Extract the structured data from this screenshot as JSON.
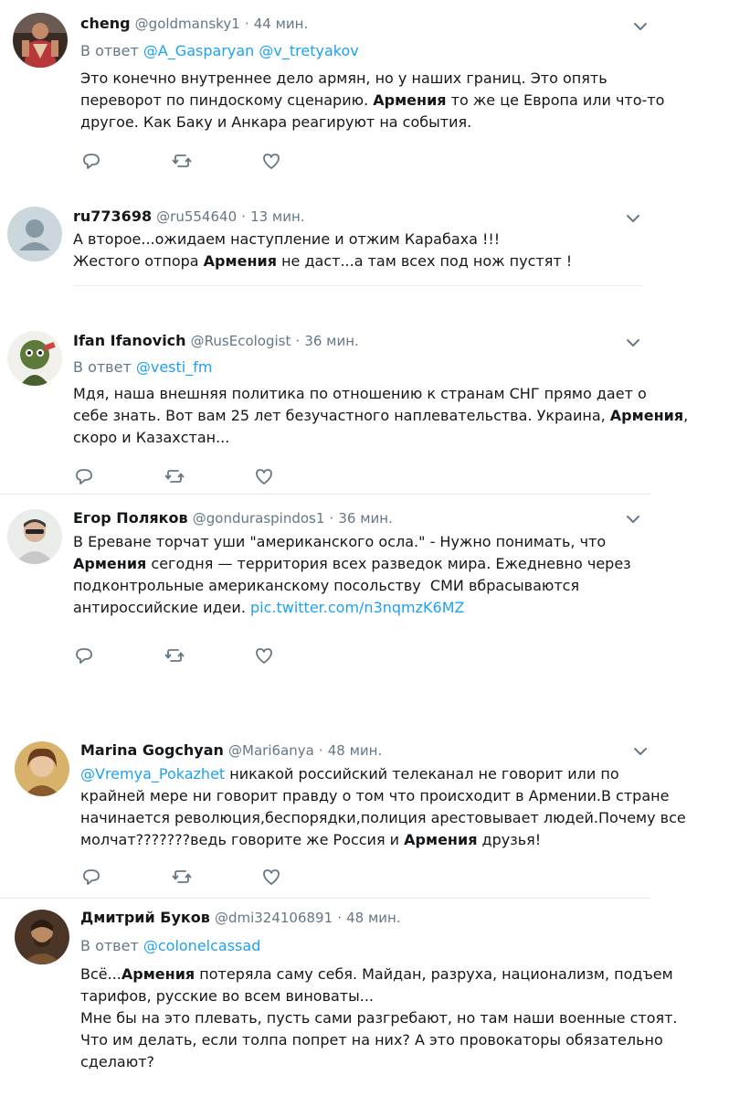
{
  "tweets": [
    {
      "name": "cheng",
      "handle": "@goldmansky1",
      "dot": "·",
      "time": "44 мин.",
      "reply_prefix": "В ответ",
      "reply_to": [
        "@A_Gasparyan",
        "@v_tretyakov"
      ],
      "lines": [
        [
          "Это конечно внутреннее дело армян, но у наших границ. Это опять"
        ],
        [
          "переворот по пиндоскому сценарию. ",
          {
            "b": "Армения"
          },
          " то же це Европа или что-то"
        ],
        [
          "другое. Как Баку и Анкара реагируют на события."
        ]
      ]
    },
    {
      "name": "ru773698",
      "handle": "@ru554640",
      "dot": "·",
      "time": "13 мин.",
      "lines": [
        [
          "А второе...ожидаем наступление и отжим Карабаха !!!"
        ],
        [
          "Жестого отпора ",
          {
            "b": "Армения"
          },
          " не даст...а там всех под нож пустят !"
        ]
      ]
    },
    {
      "name": "Ifan Ifanovich",
      "handle": "@RusEcologist",
      "dot": "·",
      "time": "36 мин.",
      "reply_prefix": "В ответ",
      "reply_to": [
        "@vesti_fm"
      ],
      "lines": [
        [
          "Мдя, наша внешняя политика по отношению к странам СНГ прямо дает о"
        ],
        [
          "себе знать. Вот вам 25 лет безучастного наплевательства. Украина, ",
          {
            "b": "Армения"
          },
          ","
        ],
        [
          "скоро и Казахстан..."
        ]
      ]
    },
    {
      "name": "Егор Поляков",
      "handle": "@gonduraspindos1",
      "dot": "·",
      "time": "36 мин.",
      "lines": [
        [
          "В Ереване торчат уши \"американского осла.\" - Нужно понимать, что"
        ],
        [
          {
            "b": "Армения"
          },
          " сегодня — территория всех разведок мира. Ежедневно через"
        ],
        [
          "подконтрольные американскому посольству  СМИ вбрасываются"
        ],
        [
          "антироссийские идеи. ",
          {
            "a": "pic.twitter.com/n3nqmzK6MZ"
          }
        ]
      ]
    },
    {
      "name": "Marina Gogchyan",
      "handle": "@Mari6anya",
      "dot": "·",
      "time": "48 мин.",
      "lines": [
        [
          {
            "a": "@Vremya_Pokazhet"
          },
          " никакой российский телеканал не говорит или по"
        ],
        [
          "крайней мере ни говорит правду о том что происходит в Армении.В стране"
        ],
        [
          "начинается революция,беспорядки,полиция арестовывает людей.Почему все"
        ],
        [
          "молчат???????ведь говорите же Россия и ",
          {
            "b": "Армения"
          },
          " друзья!"
        ]
      ]
    },
    {
      "name": "Дмитрий Буков",
      "handle": "@dmi324106891",
      "dot": "·",
      "time": "48 мин.",
      "reply_prefix": "В ответ",
      "reply_to": [
        "@colonelcassad"
      ],
      "lines": [
        [
          "Всё...",
          {
            "b": "Армения"
          },
          " потеряла саму себя. Майдан, разруха, национализм, подъем"
        ],
        [
          "тарифов, русские во всем виноваты..."
        ],
        [
          "Мне бы на это плевать, пусть сами разгребают, но там наши военные стоят."
        ],
        [
          "Что им делать, если толпа попрет на них? А это провокаторы обязательно"
        ],
        [
          "сделают?"
        ]
      ]
    }
  ],
  "colors": {
    "text": "#14171a",
    "muted": "#657786",
    "link": "#1da1f2",
    "separator": "#e6ecf0"
  },
  "icons": {
    "reply": "reply-icon",
    "retweet": "retweet-icon",
    "like": "like-icon",
    "menu": "chevron-down-icon"
  }
}
